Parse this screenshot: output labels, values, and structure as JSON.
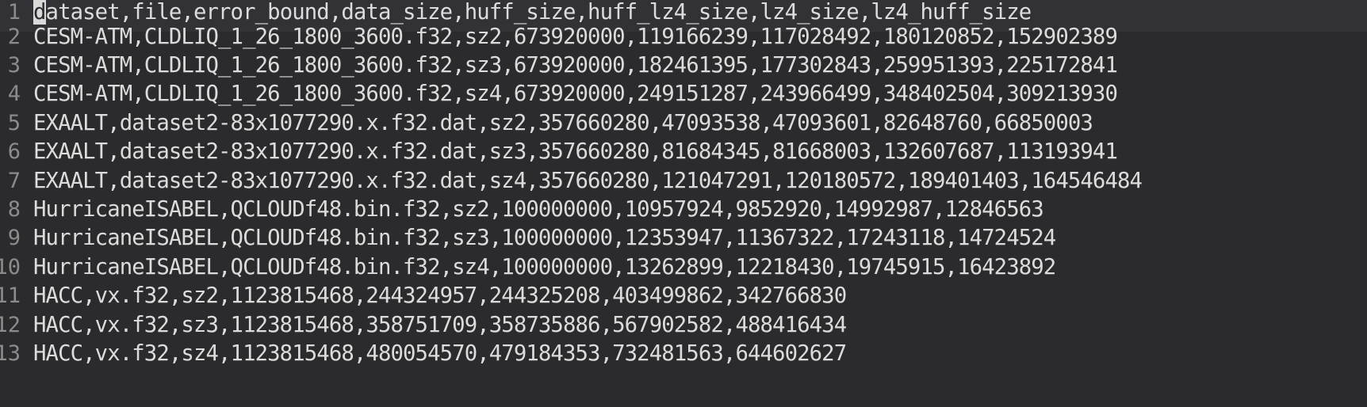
{
  "editor": {
    "current_line": 1,
    "lines": [
      {
        "number": "1",
        "cursor_char": "d",
        "text": "ataset,file,error_bound,data_size,huff_size,huff_lz4_size,lz4_size,lz4_huff_size"
      },
      {
        "number": "2",
        "text": "CESM-ATM,CLDLIQ_1_26_1800_3600.f32,sz2,673920000,119166239,117028492,180120852,152902389"
      },
      {
        "number": "3",
        "text": "CESM-ATM,CLDLIQ_1_26_1800_3600.f32,sz3,673920000,182461395,177302843,259951393,225172841"
      },
      {
        "number": "4",
        "text": "CESM-ATM,CLDLIQ_1_26_1800_3600.f32,sz4,673920000,249151287,243966499,348402504,309213930"
      },
      {
        "number": "5",
        "text": "EXAALT,dataset2-83x1077290.x.f32.dat,sz2,357660280,47093538,47093601,82648760,66850003"
      },
      {
        "number": "6",
        "text": "EXAALT,dataset2-83x1077290.x.f32.dat,sz3,357660280,81684345,81668003,132607687,113193941"
      },
      {
        "number": "7",
        "text": "EXAALT,dataset2-83x1077290.x.f32.dat,sz4,357660280,121047291,120180572,189401403,164546484"
      },
      {
        "number": "8",
        "text": "HurricaneISABEL,QCLOUDf48.bin.f32,sz2,100000000,10957924,9852920,14992987,12846563"
      },
      {
        "number": "9",
        "text": "HurricaneISABEL,QCLOUDf48.bin.f32,sz3,100000000,12353947,11367322,17243118,14724524"
      },
      {
        "number": "10",
        "text": "HurricaneISABEL,QCLOUDf48.bin.f32,sz4,100000000,13262899,12218430,19745915,16423892"
      },
      {
        "number": "11",
        "text": "HACC,vx.f32,sz2,1123815468,244324957,244325208,403499862,342766830"
      },
      {
        "number": "12",
        "text": "HACC,vx.f32,sz3,1123815468,358751709,358735886,567902582,488416434"
      },
      {
        "number": "13",
        "text": "HACC,vx.f32,sz4,1123815468,480054570,479184353,732481563,644602627"
      }
    ]
  }
}
